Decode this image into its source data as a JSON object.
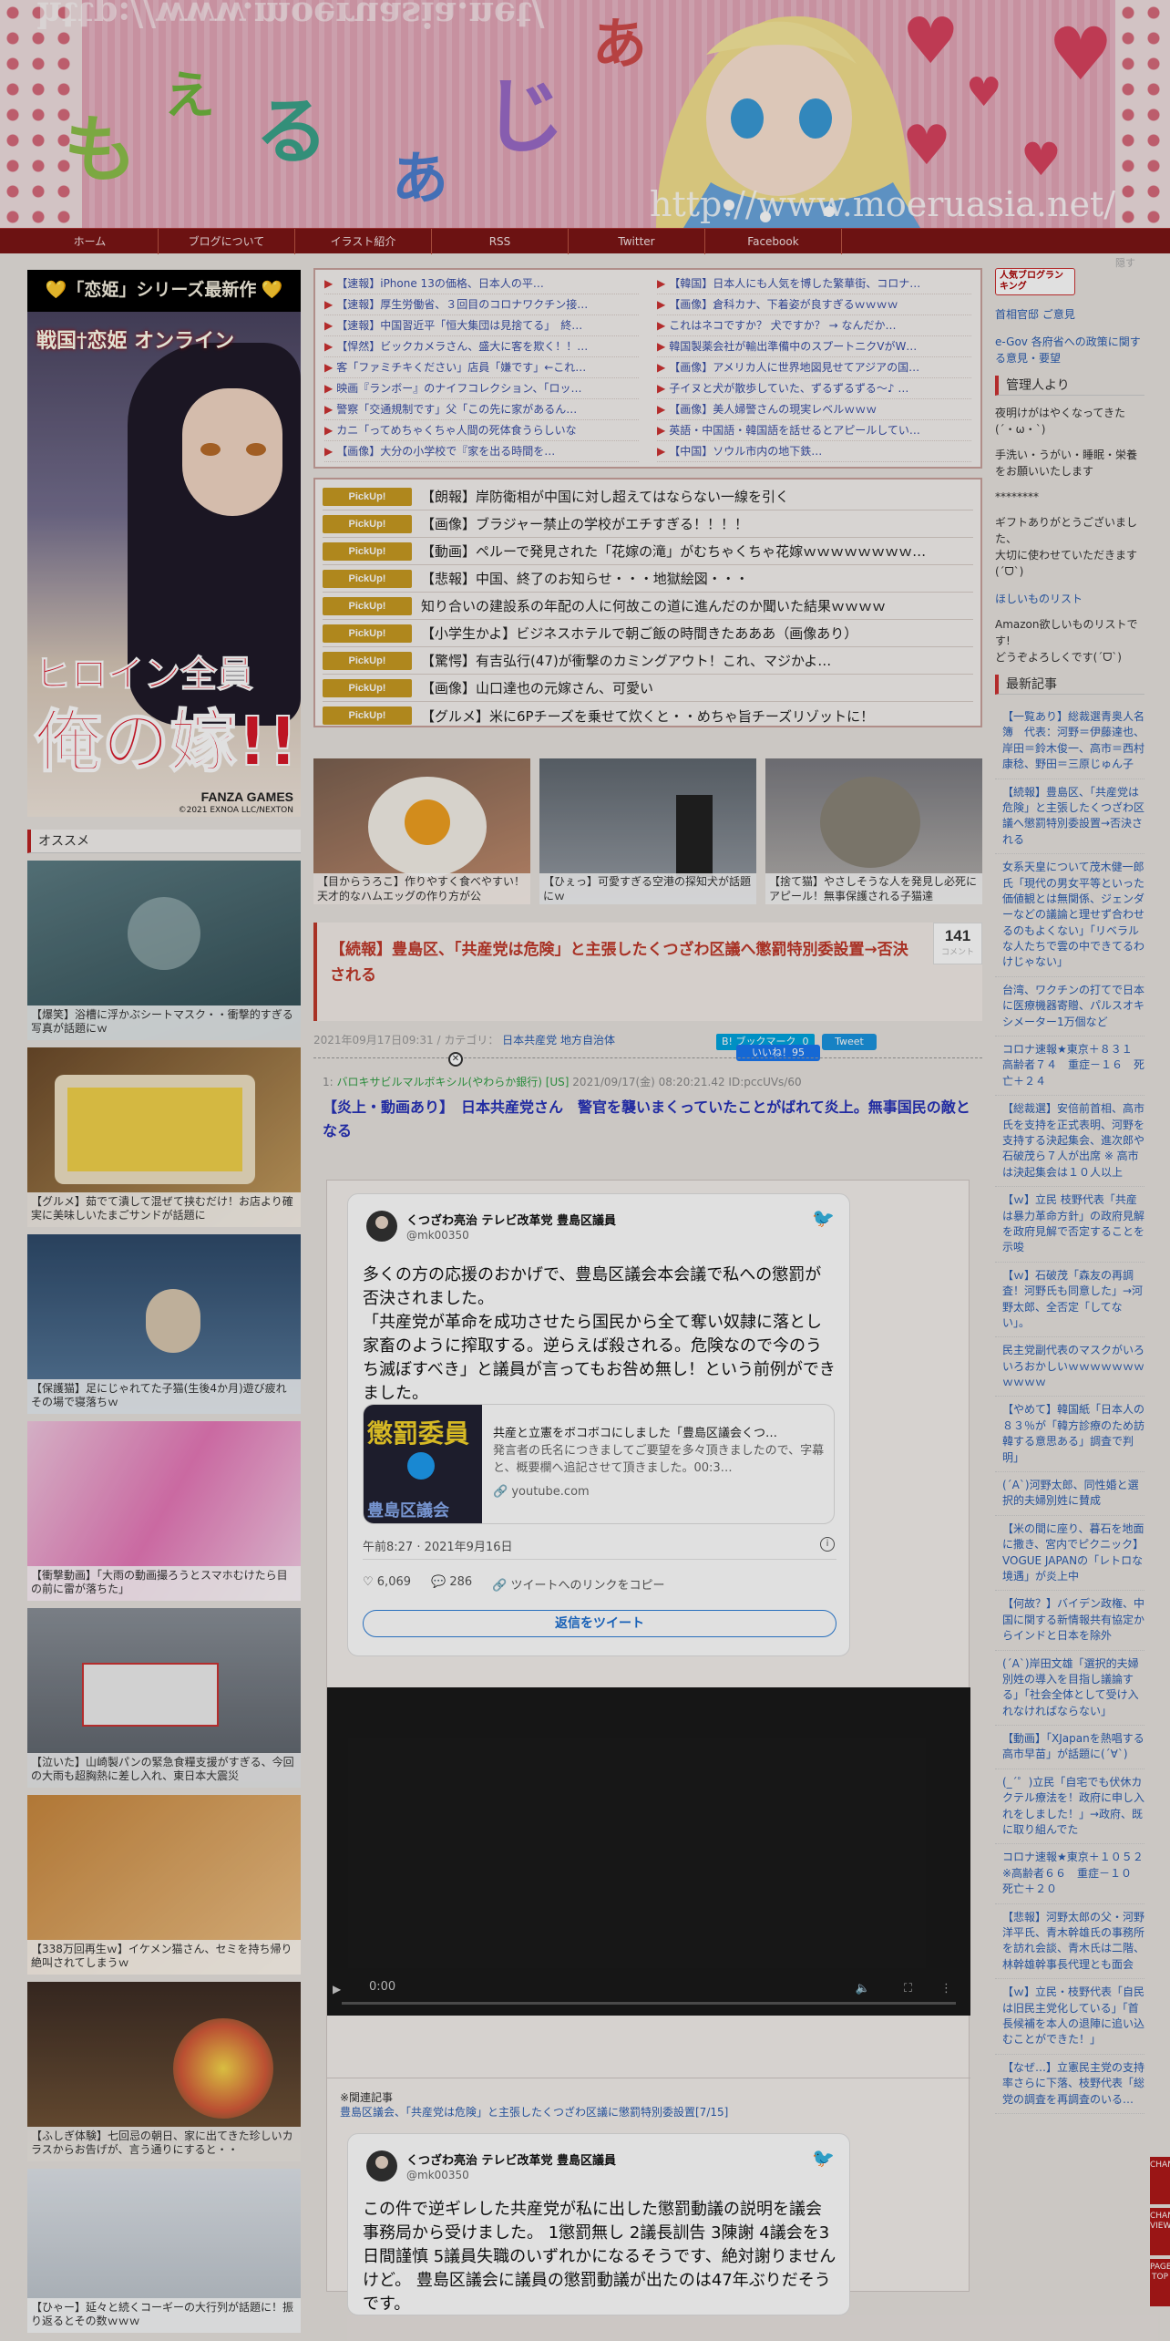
{
  "banner": {
    "url": "http://www.moeruasia.net/",
    "logo_chars": [
      "も",
      "え",
      "る",
      "あ",
      "じ",
      "あ"
    ]
  },
  "nav": {
    "items": [
      "ホーム",
      "ブログについて",
      "イラスト紹介",
      "RSS",
      "Twitter",
      "Facebook"
    ],
    "hide_label": "隠す"
  },
  "left": {
    "promo": {
      "title": "💛「恋姫」シリーズ最新作 💛",
      "game_logo": "戦国†恋姫 オンライン",
      "big1": "ヒロイン全員",
      "big2": "俺の嫁!!",
      "brand": "FANZA GAMES",
      "copyright": "©2021 EXNOA LLC/NEXTON"
    },
    "section_title": "オススメ",
    "thumbs": [
      "【爆笑】浴槽に浮かぶシートマスク・・衝撃的すぎる写真が話題にｗ",
      "【グルメ】茹でて潰して混ぜて挟むだけ！お店より確実に美味しいたまごサンドが話題に",
      "【保護猫】足にじゃれてた子猫(生後4か月)遊び疲れその場で寝落ちｗ",
      "【衝撃動画】「大雨の動画撮ろうとスマホむけたら目の前に雷が落ちた」",
      "【泣いた】山崎製パンの緊急食糧支援がすぎる、今回の大雨も超胸熱に差し入れ、東日本大震災",
      "【338万回再生ｗ】イケメン猫さん、セミを持ち帰り絶叫されてしまうｗ",
      "【ふしぎ体験】七回忌の朝日、家に出てきた珍しいカラスからお告げが、言う通りにすると・・",
      "【ひゃー】延々と続くコーギーの大行列が話題に！振り返るとその数ｗｗｗ"
    ]
  },
  "main": {
    "rss_left": [
      "【速報】iPhone 13の価格、日本人の平…",
      "【速報】厚生労働省、３回目のコロナワクチン接…",
      "【速報】中国習近平「恒大集団は見捨てる」　終…",
      "【悍然】ビックカメラさん、盛大に客を欺く！！…",
      "客「ファミチキください」店員「嫌です」←これ…",
      "映画『ランボー』のナイフコレクション、「ロッ…",
      "警察「交通規制です」父「この先に家があるん…",
      "カニ「ってめちゃくちゃ人間の死体食うらしいな",
      "【画像】大分の小学校で『家を出る時間を…"
    ],
    "rss_right": [
      "【韓国】日本人にも人気を博した繁華街、コロナ…",
      "【画像】倉科カナ、下着姿が良すぎるｗｗｗｗ",
      "これはネコですか？ 犬ですか？ → なんだか…",
      "韓国製薬会社が輸出準備中のスプートニクVがW…",
      "【画像】アメリカ人に世界地図見せてアジアの国…",
      "子イヌと犬が散歩していた、ずるずるずる〜♪ …",
      "【画像】美人婦警さんの現実レベルｗｗｗ",
      "英語・中国語・韓国語を話せるとアピールしてい…",
      "【中国】ソウル市内の地下鉄…"
    ],
    "pickup_label": "PickUp!",
    "pickups": [
      "【朗報】岸防衛相が中国に対し超えてはならない一線を引く",
      "【画像】ブラジャー禁止の学校がエチすぎる！！！！",
      "【動画】ペルーで発見された「花嫁の滝」がむちゃくちゃ花嫁ｗｗｗｗｗｗｗｗ…",
      "【悲報】中国、終了のお知らせ・・・地獄絵図・・・",
      "知り合いの建設系の年配の人に何故この道に進んだのか聞いた結果ｗｗｗｗ",
      "【小学生かよ】ビジネスホテルで朝ご飯の時間きたあああ（画像あり）",
      "【驚愕】有吉弘行(47)が衝撃のカミングアウト！これ、マジかよ…",
      "【画像】山口達也の元嫁さん、可愛い",
      "【グルメ】米に6Pチーズを乗せて炊くと・・めちゃ旨チーズリゾットに！"
    ],
    "features": [
      "【目からうろこ】作りやすく食べやすい！天才的なハムエッグの作り方が公",
      "【ひぇっ】可愛すぎる空港の探知犬が話題にｗ",
      "【捨て猫】やさしそうな人を発見し必死にアピール！無事保護される子猫達"
    ],
    "post": {
      "title": "【続報】豊島区、「共産党は危険」と主張したくつざわ区議へ懲罰特別委設置→否決される",
      "count": "141",
      "count_label": "コメント",
      "date": "2021年09月17日09:31 / カテゴリ：",
      "category": "日本共産党 地方自治体",
      "hatena": "B! ブックマーク",
      "hatena_count": "0",
      "tweet_btn": "Tweet",
      "like_btn": "いいね！95"
    },
    "res": {
      "num": "1:",
      "name": "バロキサビルマルボキシル(やわらか銀行) [US]",
      "date": "2021/09/17(金) 08:20:21.42 ID:pccUVs/60",
      "body": "【炎上・動画あり】　日本共産党さん　警官を襲いまくっていたことがばれて炎上。無事国民の敵となる"
    },
    "tweet1": {
      "name": "くつざわ亮治 テレビ改革党 豊島区議員",
      "handle": "@mk00350",
      "body": "多くの方の応援のおかげで、豊島区議会本会議で私への懲罰が否決されました。\n「共産党が革命を成功させたら国民から全て奪い奴隷に落とし家畜のように搾取する。逆らえば殺される。危険なので今のうち滅ぼすべき」と議員が言ってもお咎め無し！という前例ができました。",
      "card_title": "共産と立憲をボコボコにしました「豊島区議会くつ…",
      "card_desc": "発言者の氏名につきましてご要望を多々頂きましたので、字幕と、概要欄へ追記させて頂きました。00:3…",
      "card_url": "🔗 youtube.com",
      "card_img_text": "懲罰委員",
      "card_img_sub": "豊島区議会",
      "timestamp": "午前8:27 · 2021年9月16日",
      "likes": "♡  6,069",
      "replies": "💬  286",
      "copy": "🔗  ツイートへのリンクをコピー",
      "reply_btn": "返信をツイート"
    },
    "video": {
      "time": "0:00"
    },
    "related": {
      "head": "※関連記事",
      "link": "豊島区議会、「共産党は危険」と主張したくつざわ区議に懲罰特別委設置[7/15]"
    },
    "tweet2": {
      "name": "くつざわ亮治 テレビ改革党 豊島区議員",
      "handle": "@mk00350",
      "body": "この件で逆ギレした共産党が私に出した懲罰動議の説明を議会事務局から受けました。\n1懲罰無し 2議長訓告 3陳謝 4議会を3日間謹慎 5議員失職のいずれかになるそうです、絶対謝りませんけど。\n豊島区議会に議員の懲罰動議が出たのは47年ぶりだそうです。"
    }
  },
  "right": {
    "rank_btn": "人気ブログランキング",
    "links_top": [
      "首相官邸 ご意見",
      "e-Gov 各府省への政策に関する意見・要望"
    ],
    "kanri_head": "管理人より",
    "kanri_texts": [
      "夜明けがはやくなってきた(´・ω・`)",
      "手洗い・うがい・睡眠・栄養をお願いいたします",
      "********",
      "ギフトありがとうございました、\n大切に使わせていただきます(ˊᗜˋ)",
      "ほしいものリスト",
      "Amazon欲しいものリストです!\nどうぞよろしくです(ˊᗜˋ)"
    ],
    "latest_head": "最新記事",
    "latest": [
      "【一覧あり】総裁選青奥人名簿　代表：河野＝伊藤達也、岸田＝鈴木俊一、高市＝西村康稔、野田＝三原じゅん子",
      "【続報】豊島区、「共産党は危険」と主張したくつざわ区議へ懲罰特別委設置→否決される",
      "女系天皇について茂木健一郎氏「現代の男女平等といった価値観とは無関係、ジェンダーなどの議論と理せず合わせるのもよくない」「リベラルな人たちで雲の中できてるわけじゃない」",
      "台湾、ワクチンの打てで日本に医療機器寄贈、パルスオキシメーター1万個など",
      "コロナ速報★東京＋８３１　高齢者７４　重症－１６　死亡＋２４",
      "【総裁選】安倍前首相、高市氏を支持を正式表明、河野を支持する決起集会、進次郎や石破茂ら７人が出席 ※ 高市は決起集会は１０人以上",
      "【ｗ】立民 枝野代表「共産は暴力革命方針」の政府見解を政府見解で否定することを示唆",
      "【ｗ】石破茂「森友の再調査！河野氏も同意した」→河野太郎、全否定「してない」。",
      "民主党副代表のマスクがいろいろおかしいｗｗｗｗｗｗｗｗｗｗｗ",
      "【やめて】韓国紙「日本人の８３％が「韓方診療のため訪韓する意思ある」調査で判明」",
      "(ˊAˋ)河野太郎、同性婚と選択的夫婦別姓に賛成",
      "【米の間に座り、暮石を地面に撒き、宮内でピクニック】VOGUE JAPANの「レトロな境遇」が炎上中",
      "【何故？】バイデン政権、中国に関する新情報共有協定からインドと日本を除外",
      "(ˊAˋ)岸田文雄「選択的夫婦別姓の導入を目指し議論する」「社会全体として受け入れなければならない」",
      "【動画】「XJapanを熱唱する高市早苗」が話題に(ˊ∀ˋ)",
      "(_´゜)立民「自宅でも伏休カクテル療法を！政府に申し入れをしました！」→政府、既に取り組んでた",
      "コロナ速報★東京＋１０５２　※高齢者６６　重症－１０　死亡＋２０",
      "【悲報】河野太郎の父・河野洋平氏、青木幹雄氏の事務所を訪れ会談、青木氏は二階、林幹雄幹事長代理とも面会",
      "【ｗ】立民・枝野代表「自民は旧民主党化している」「首長候補を本人の退陣に追い込むことができた！」",
      "【なぜ…】立憲民主党の支持率さらに下落、枝野代表「総党の調査を再調査のいる…"
    ],
    "side_tabs": [
      "CHANGE",
      "CHANGE VIEW",
      "PAGE TOP"
    ]
  }
}
